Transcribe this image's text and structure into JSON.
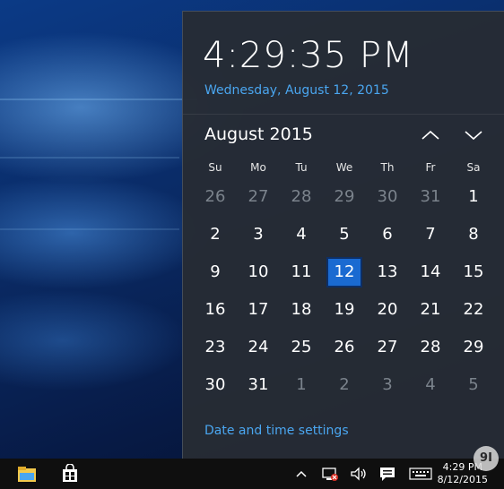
{
  "flyout": {
    "time": "4:29:35 PM",
    "long_date": "Wednesday, August 12, 2015",
    "month_label": "August 2015",
    "prev_icon": "chevron-up-icon",
    "next_icon": "chevron-down-icon",
    "weekdays": [
      "Su",
      "Mo",
      "Tu",
      "We",
      "Th",
      "Fr",
      "Sa"
    ],
    "weeks": [
      [
        {
          "d": "26",
          "dim": true
        },
        {
          "d": "27",
          "dim": true
        },
        {
          "d": "28",
          "dim": true
        },
        {
          "d": "29",
          "dim": true
        },
        {
          "d": "30",
          "dim": true
        },
        {
          "d": "31",
          "dim": true
        },
        {
          "d": "1",
          "dim": false
        }
      ],
      [
        {
          "d": "2",
          "dim": false
        },
        {
          "d": "3",
          "dim": false
        },
        {
          "d": "4",
          "dim": false
        },
        {
          "d": "5",
          "dim": false
        },
        {
          "d": "6",
          "dim": false
        },
        {
          "d": "7",
          "dim": false
        },
        {
          "d": "8",
          "dim": false
        }
      ],
      [
        {
          "d": "9",
          "dim": false
        },
        {
          "d": "10",
          "dim": false
        },
        {
          "d": "11",
          "dim": false
        },
        {
          "d": "12",
          "dim": false,
          "today": true
        },
        {
          "d": "13",
          "dim": false
        },
        {
          "d": "14",
          "dim": false
        },
        {
          "d": "15",
          "dim": false
        }
      ],
      [
        {
          "d": "16",
          "dim": false
        },
        {
          "d": "17",
          "dim": false
        },
        {
          "d": "18",
          "dim": false
        },
        {
          "d": "19",
          "dim": false
        },
        {
          "d": "20",
          "dim": false
        },
        {
          "d": "21",
          "dim": false
        },
        {
          "d": "22",
          "dim": false
        }
      ],
      [
        {
          "d": "23",
          "dim": false
        },
        {
          "d": "24",
          "dim": false
        },
        {
          "d": "25",
          "dim": false
        },
        {
          "d": "26",
          "dim": false
        },
        {
          "d": "27",
          "dim": false
        },
        {
          "d": "28",
          "dim": false
        },
        {
          "d": "29",
          "dim": false
        }
      ],
      [
        {
          "d": "30",
          "dim": false
        },
        {
          "d": "31",
          "dim": false
        },
        {
          "d": "1",
          "dim": true
        },
        {
          "d": "2",
          "dim": true
        },
        {
          "d": "3",
          "dim": true
        },
        {
          "d": "4",
          "dim": true
        },
        {
          "d": "5",
          "dim": true
        }
      ]
    ],
    "settings_link": "Date and time settings"
  },
  "taskbar": {
    "tray_time": "4:29 PM",
    "tray_date": "8/12/2015",
    "icons": [
      "file-explorer-icon",
      "store-icon",
      "show-hidden-icons-icon",
      "network-icon",
      "volume-icon",
      "action-center-icon",
      "keyboard-icon"
    ]
  },
  "watermark": "9I",
  "colors": {
    "accent": "#4aa6f0",
    "selected": "#1a6ad1",
    "flyout_bg": "#262c34",
    "taskbar": "#0f0f0f"
  }
}
